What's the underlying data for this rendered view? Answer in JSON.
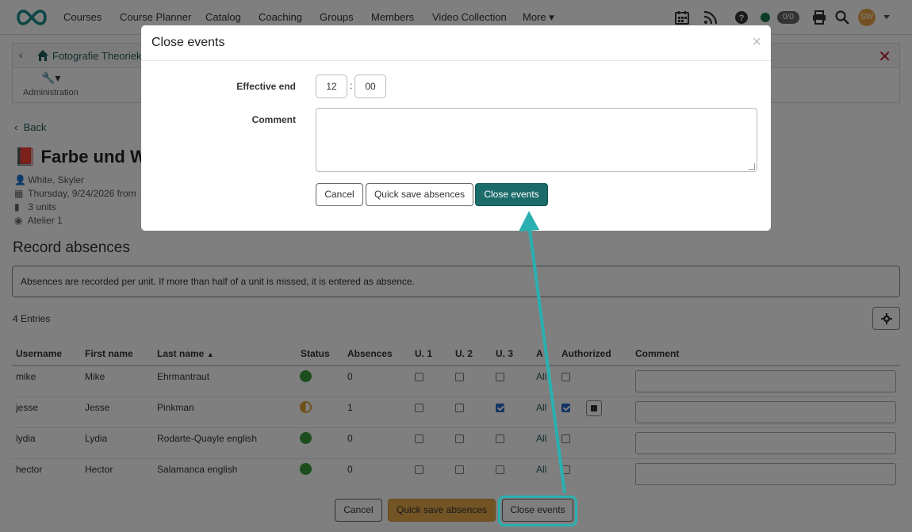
{
  "nav": {
    "items": [
      "Courses",
      "Course Planner",
      "Catalog",
      "Coaching",
      "Groups",
      "Members",
      "Video Collection",
      "More"
    ],
    "counter": "0/0",
    "avatar_initials": "SW"
  },
  "breadcrumb": {
    "text": "Fotografie Theorieku"
  },
  "toolbar": {
    "admin_label": "Administration"
  },
  "page": {
    "back_label": "Back",
    "title": "Farbe und Wei",
    "meta": [
      "White, Skyler",
      "Thursday, 9/24/2026 from",
      "3 units",
      "Atelier 1"
    ],
    "section_title": "Record absences",
    "info": "Absences are recorded per unit. If more than half of a unit is missed, it is entered as absence.",
    "entries": "4 Entries"
  },
  "table": {
    "headers": [
      "Username",
      "First name",
      "Last name",
      "Status",
      "Absences",
      "U. 1",
      "U. 2",
      "U. 3",
      "A",
      "Authorized",
      "Comment"
    ],
    "all_label": "All",
    "rows": [
      {
        "username": "mike",
        "first": "Mike",
        "last": "Ehrmantraut",
        "status": "green",
        "absences": "0",
        "u1": false,
        "u2": false,
        "u3": false,
        "authorized": false
      },
      {
        "username": "jesse",
        "first": "Jesse",
        "last": "Pinkman",
        "status": "half",
        "absences": "1",
        "u1": false,
        "u2": false,
        "u3": true,
        "authorized": true
      },
      {
        "username": "lydia",
        "first": "Lydia",
        "last": "Rodarte-Quayle english",
        "status": "green",
        "absences": "0",
        "u1": false,
        "u2": false,
        "u3": false,
        "authorized": false
      },
      {
        "username": "hector",
        "first": "Hector",
        "last": "Salamanca english",
        "status": "green",
        "absences": "0",
        "u1": false,
        "u2": false,
        "u3": false,
        "authorized": false
      }
    ]
  },
  "footer": {
    "cancel": "Cancel",
    "quick_save": "Quick save absences",
    "close_events": "Close events"
  },
  "modal": {
    "title": "Close events",
    "close_glyph": "×",
    "effective_end_label": "Effective end",
    "hour": "12",
    "minute": "00",
    "comment_label": "Comment",
    "cancel": "Cancel",
    "quick_save": "Quick save absences",
    "close_events": "Close events"
  },
  "colors": {
    "accent": "#1b6b6b",
    "warn": "#e4a84a",
    "highlight": "#2ab0b0",
    "status_green": "#3a9a3a",
    "status_half": "#e0a030"
  }
}
